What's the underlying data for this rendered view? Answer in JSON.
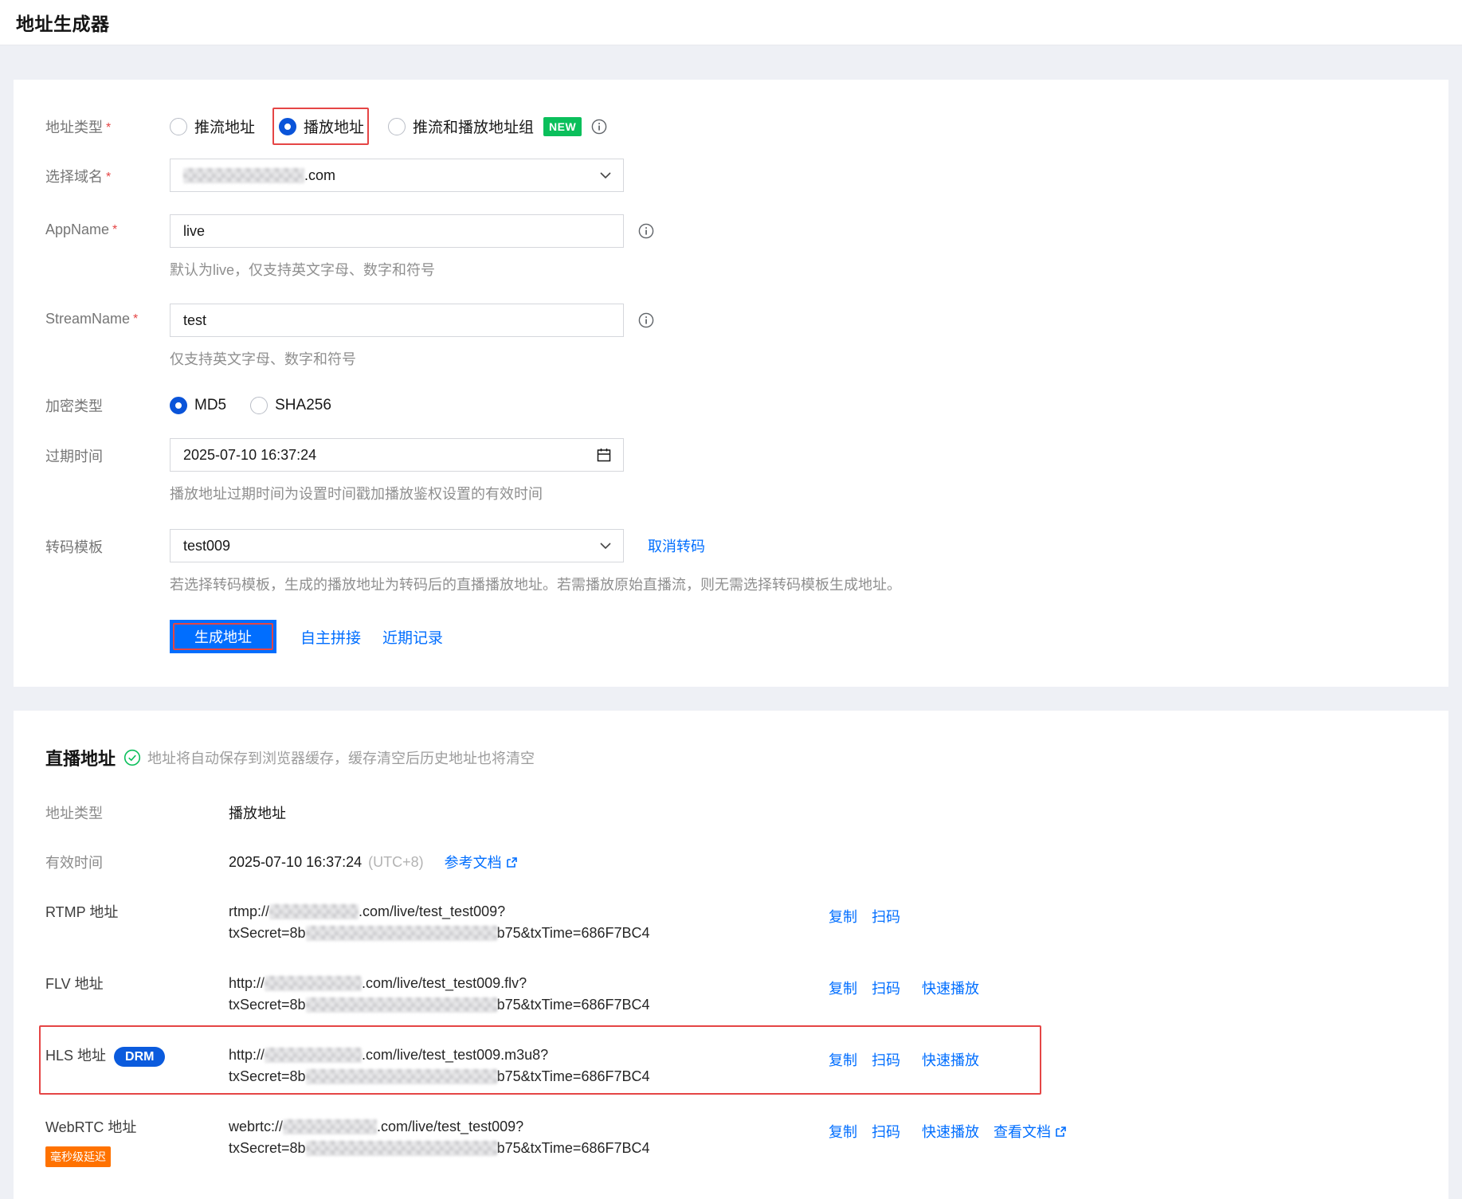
{
  "page": {
    "title": "地址生成器",
    "required_mark": "*"
  },
  "colors": {
    "accent": "#006eff",
    "radio_blue": "#0a54d9",
    "annotation_red": "#e54545",
    "new_badge_green": "#0abf5b",
    "drm_badge_blue": "#0b5bdd",
    "delay_badge_orange": "#ff7200"
  },
  "generator": {
    "address_type": {
      "label": "地址类型",
      "options": [
        {
          "label": "推流地址",
          "selected": false
        },
        {
          "label": "播放地址",
          "selected": true
        },
        {
          "label": "推流和播放地址组",
          "selected": false
        }
      ],
      "new_badge": "NEW"
    },
    "domain": {
      "label": "选择域名",
      "value_suffix": ".com"
    },
    "app_name": {
      "label": "AppName",
      "value": "live",
      "help": "默认为live，仅支持英文字母、数字和符号"
    },
    "stream_name": {
      "label": "StreamName",
      "value": "test",
      "help": "仅支持英文字母、数字和符号"
    },
    "encrypt_type": {
      "label": "加密类型",
      "options": [
        {
          "label": "MD5",
          "selected": true
        },
        {
          "label": "SHA256",
          "selected": false
        }
      ]
    },
    "expire_time": {
      "label": "过期时间",
      "value": "2025-07-10 16:37:24",
      "help": "播放地址过期时间为设置时间戳加播放鉴权设置的有效时间"
    },
    "transcode": {
      "label": "转码模板",
      "value": "test009",
      "cancel_link": "取消转码",
      "help": "若选择转码模板，生成的播放地址为转码后的直播播放地址。若需播放原始直播流，则无需选择转码模板生成地址。"
    },
    "generate_button": "生成地址",
    "manual_link": "自主拼接",
    "recent_link": "近期记录"
  },
  "result": {
    "title": "直播地址",
    "note": "地址将自动保存到浏览器缓存，缓存清空后历史地址也将清空",
    "address_type": {
      "label": "地址类型",
      "value": "播放地址"
    },
    "valid_time": {
      "label": "有效时间",
      "value": "2025-07-10 16:37:24",
      "timezone": "(UTC+8)",
      "doc_link": "参考文档"
    },
    "actions": {
      "copy": "复制",
      "scan": "扫码",
      "quick_play": "快速播放",
      "view_doc": "查看文档"
    },
    "addresses": {
      "rtmp": {
        "label": "RTMP 地址",
        "url_prefix": "rtmp://",
        "url_suffix": ".com/live/test_test009?",
        "secret_prefix": "txSecret=8b",
        "secret_suffix": "b75&txTime=686F7BC4"
      },
      "flv": {
        "label": "FLV 地址",
        "url_prefix": "http://",
        "url_suffix": ".com/live/test_test009.flv?",
        "secret_prefix": "txSecret=8b",
        "secret_suffix": "b75&txTime=686F7BC4"
      },
      "hls": {
        "label": "HLS 地址",
        "badge": "DRM",
        "url_prefix": "http://",
        "url_suffix": ".com/live/test_test009.m3u8?",
        "secret_prefix": "txSecret=8b",
        "secret_suffix": "b75&txTime=686F7BC4"
      },
      "webrtc": {
        "label": "WebRTC 地址",
        "badge": "毫秒级延迟",
        "url_prefix": "webrtc://",
        "url_suffix": ".com/live/test_test009?",
        "secret_prefix": "txSecret=8b",
        "secret_suffix": "b75&txTime=686F7BC4"
      }
    }
  }
}
